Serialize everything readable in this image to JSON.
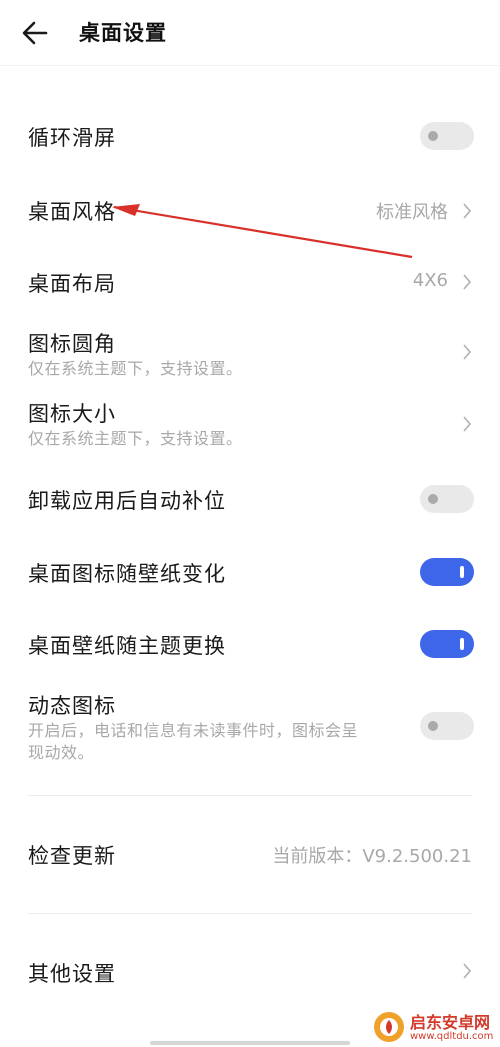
{
  "header": {
    "title": "桌面设置",
    "back_icon": "arrow-left-icon"
  },
  "settings": [
    {
      "label": "循环滑屏",
      "type": "toggle",
      "enabled": false
    },
    {
      "label": "桌面风格",
      "type": "nav",
      "value": "标准风格"
    },
    {
      "label": "桌面布局",
      "type": "nav",
      "value": "4X6"
    },
    {
      "label": "图标圆角",
      "subtitle": "仅在系统主题下，支持设置。",
      "type": "nav"
    },
    {
      "label": "图标大小",
      "subtitle": "仅在系统主题下，支持设置。",
      "type": "nav"
    },
    {
      "label": "卸载应用后自动补位",
      "type": "toggle",
      "enabled": false
    },
    {
      "label": "桌面图标随壁纸变化",
      "type": "toggle",
      "enabled": true
    },
    {
      "label": "桌面壁纸随主题更换",
      "type": "toggle",
      "enabled": true
    },
    {
      "label": "动态图标",
      "subtitle_line1": "开启后，电话和信息有未读事件时，图标会呈",
      "subtitle_line2": "现动效。",
      "type": "toggle",
      "enabled": false
    }
  ],
  "update": {
    "label": "检查更新",
    "value": "当前版本：V9.2.500.21"
  },
  "other": {
    "label": "其他设置"
  },
  "colors": {
    "toggle_on": "#3d66e8",
    "toggle_off": "#e9e9e9",
    "annotation_arrow": "#d9302a"
  },
  "watermark": {
    "name": "启东安卓网",
    "url": "www.qdltdu.com"
  }
}
